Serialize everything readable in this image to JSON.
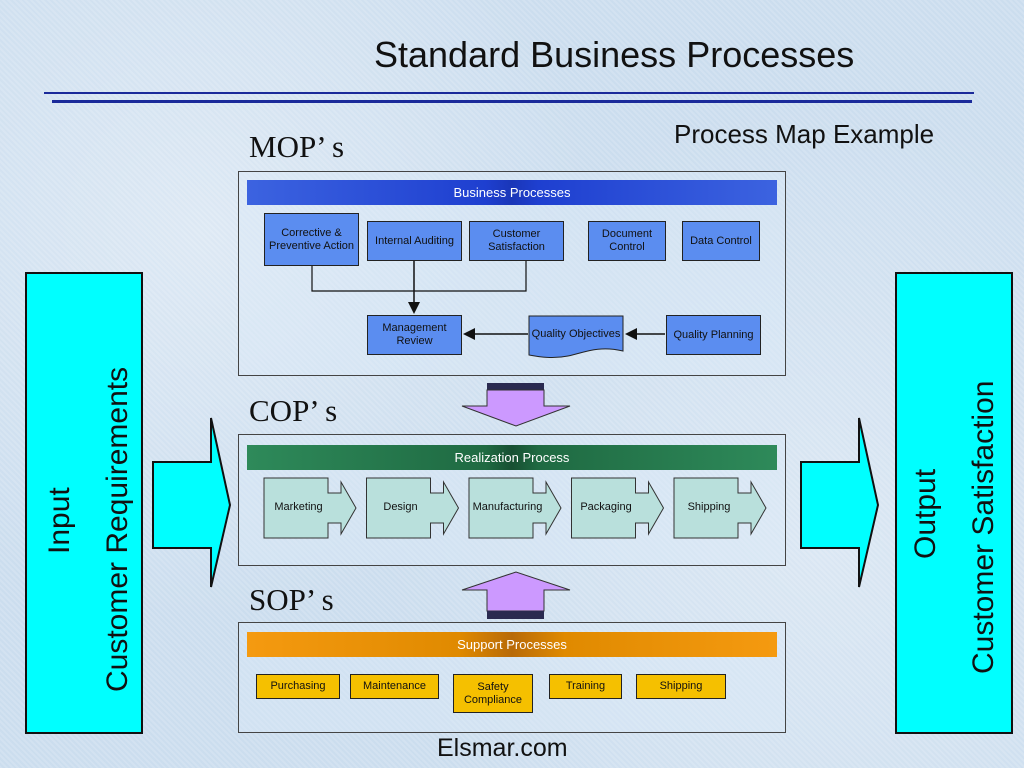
{
  "title": "Standard Business Processes",
  "subtitle": "Process Map Example",
  "footer": "Elsmar.com",
  "input_block": {
    "line1": "Input",
    "line2": "Customer Requirements"
  },
  "output_block": {
    "line1": "Output",
    "line2": "Customer Satisfaction"
  },
  "mop": {
    "label": "MOP’ s",
    "band": "Business Processes",
    "top_boxes": [
      {
        "label": "Corrective & Preventive Action"
      },
      {
        "label": "Internal Auditing"
      },
      {
        "label": "Customer Satisfaction"
      },
      {
        "label": "Document Control"
      },
      {
        "label": "Data Control"
      }
    ],
    "bottom_boxes": [
      {
        "label": "Management Review"
      },
      {
        "label": "Quality Objectives"
      },
      {
        "label": "Quality Planning"
      }
    ]
  },
  "cop": {
    "label": "COP’ s",
    "band": "Realization Process",
    "steps": [
      "Marketing",
      "Design",
      "Manufacturing",
      "Packaging",
      "Shipping"
    ]
  },
  "sop": {
    "label": "SOP’ s",
    "band": "Support Processes",
    "boxes": [
      "Purchasing",
      "Maintenance",
      "Safety Compliance",
      "Training",
      "Shipping"
    ]
  },
  "colors": {
    "mop_band": "#1e3fd0",
    "mop_box": "#5b8df0",
    "cop_band": "#1f6a42",
    "cop_box": "#b9e0dc",
    "sop_band": "#e08a00",
    "sop_box": "#f5c000",
    "side_block": "#00ffff",
    "connector_arrow": "#cc99ff"
  }
}
